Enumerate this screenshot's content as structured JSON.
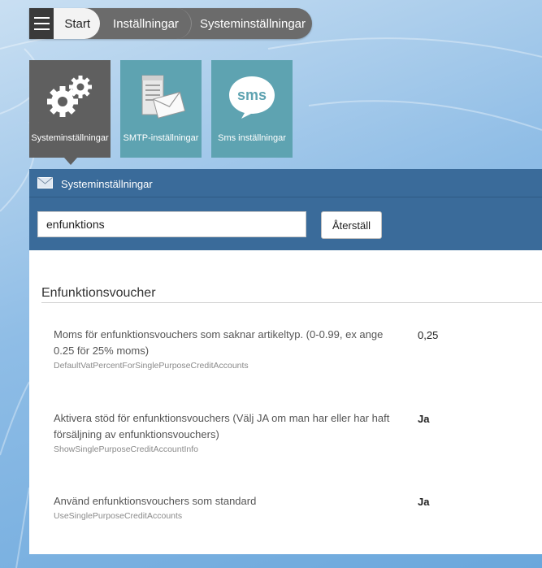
{
  "breadcrumb": {
    "items": [
      "Start",
      "Inställningar",
      "Systeminställningar"
    ]
  },
  "tiles": [
    {
      "label": "Systeminställningar",
      "icon": "gears-icon",
      "active": true
    },
    {
      "label": "SMTP-inställningar",
      "icon": "mail-server-icon"
    },
    {
      "label": "Sms inställningar",
      "icon": "sms-bubble-icon",
      "icon_text": "sms"
    }
  ],
  "panel": {
    "title": "Systeminställningar",
    "search_value": "enfunktions",
    "reset_label": "Återställ"
  },
  "section": {
    "title": "Enfunktionsvoucher",
    "settings": [
      {
        "description": "Moms för enfunktionsvouchers som saknar artikeltyp. (0-0.99, ex ange 0.25 för 25% moms)",
        "key": "DefaultVatPercentForSinglePurposeCreditAccounts",
        "value": "0,25"
      },
      {
        "description": "Aktivera stöd för enfunktionsvouchers (Välj JA om man har eller har haft försäljning av enfunktionsvouchers)",
        "key": "ShowSinglePurposeCreditAccountInfo",
        "value": "Ja"
      },
      {
        "description": "Använd enfunktionsvouchers som standard",
        "key": "UseSinglePurposeCreditAccounts",
        "value": "Ja"
      }
    ]
  },
  "colors": {
    "panel_header": "#3a6b9a",
    "tile_active": "#5f5f5f",
    "tile": "#5ea3b1"
  }
}
